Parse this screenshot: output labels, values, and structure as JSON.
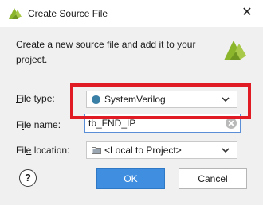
{
  "window": {
    "title": "Create Source File",
    "close_glyph": "✕",
    "logo_icon": "vivado-logo-icon",
    "accent_color": "#8bb52a"
  },
  "description": "Create a new source file and add it to your project.",
  "fields": {
    "file_type": {
      "label_prefix": "F",
      "label_rest": "ile type:",
      "value": "SystemVerilog",
      "icon": "systemverilog-dot-icon",
      "icon_color": "#3a7fa6"
    },
    "file_name": {
      "label_prefix": "F",
      "label_accel": "i",
      "label_rest": "le name:",
      "value": "tb_FND_IP"
    },
    "file_location": {
      "label_pre": "Fil",
      "label_accel": "e",
      "label_rest": " location:",
      "value": "<Local to Project>",
      "icon": "folder-icon"
    }
  },
  "buttons": {
    "help": "?",
    "ok": "OK",
    "cancel": "Cancel",
    "ok_color": "#3f8ee0"
  },
  "annotation": {
    "highlight_color": "#e01b24"
  }
}
